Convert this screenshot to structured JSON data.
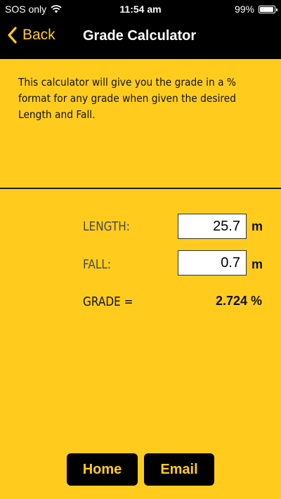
{
  "status_bar": {
    "carrier": "SOS only",
    "time": "11:54 am",
    "battery": "99%"
  },
  "nav": {
    "back_label": "Back",
    "title": "Grade Calculator"
  },
  "description": "This calculator will give you the grade in a % format for any grade when given the desired Length and Fall.",
  "form": {
    "length_label": "LENGTH:",
    "length_value": "25.7",
    "length_unit": "m",
    "fall_label": "FALL:",
    "fall_value": "0.7",
    "fall_unit": "m",
    "grade_label": "GRADE =",
    "grade_value": "2.724 %"
  },
  "buttons": {
    "home_label": "Home",
    "email_label": "Email"
  },
  "colors": {
    "accent": "#FFCC1E",
    "bar": "#000000"
  },
  "icons": {
    "wifi": "wifi-icon",
    "battery": "battery-icon",
    "back": "chevron-left-icon"
  }
}
